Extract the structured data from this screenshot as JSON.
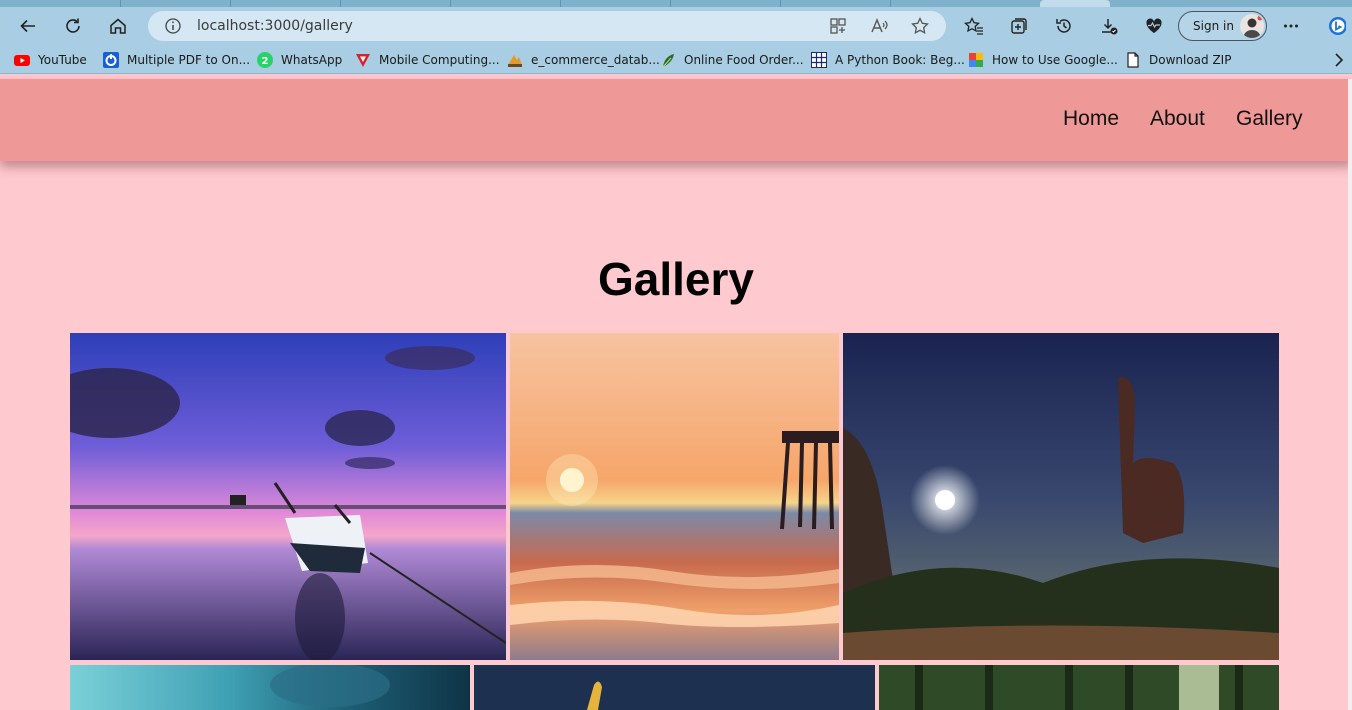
{
  "browser": {
    "url": "localhost:3000/gallery",
    "signin_label": "Sign in",
    "toolbar_icons": [
      "back-icon",
      "refresh-icon",
      "home-icon",
      "info-icon",
      "apps-icon",
      "read-aloud-icon",
      "favorite-star-icon",
      "favorites-icon",
      "collections-icon",
      "history-icon",
      "downloads-icon",
      "heart-pulse-icon",
      "more-icon",
      "bing-icon"
    ],
    "bookmarks": [
      {
        "label": "YouTube",
        "icon": "youtube-icon"
      },
      {
        "label": "Multiple PDF to On...",
        "icon": "pdf-icon"
      },
      {
        "label": "WhatsApp",
        "icon": "whatsapp-icon",
        "badge": "2"
      },
      {
        "label": "Mobile Computing...",
        "icon": "triangle-icon"
      },
      {
        "label": "e_commerce_datab...",
        "icon": "pna-icon"
      },
      {
        "label": "Online Food Order...",
        "icon": "leaf-icon"
      },
      {
        "label": "A Python Book: Beg...",
        "icon": "grid-icon"
      },
      {
        "label": "How to Use Google...",
        "icon": "google-icon"
      },
      {
        "label": "Download ZIP",
        "icon": "file-icon"
      }
    ]
  },
  "nav": {
    "links": [
      {
        "label": "Home"
      },
      {
        "label": "About"
      },
      {
        "label": "Gallery"
      }
    ]
  },
  "page": {
    "title": "Gallery"
  },
  "gallery": {
    "photos": [
      {
        "subject": "Boat on calm lake at purple sunset"
      },
      {
        "subject": "Ocean sunset with pier"
      },
      {
        "subject": "Night sky over rock formation"
      },
      {
        "subject": "Underwater scene"
      },
      {
        "subject": "Surfboard at night"
      },
      {
        "subject": "Forest with sunlight"
      }
    ]
  },
  "colors": {
    "page_bg": "#ffc9d0",
    "navbar_bg": "#ef9898",
    "browser_chrome": "#a9cde2"
  }
}
